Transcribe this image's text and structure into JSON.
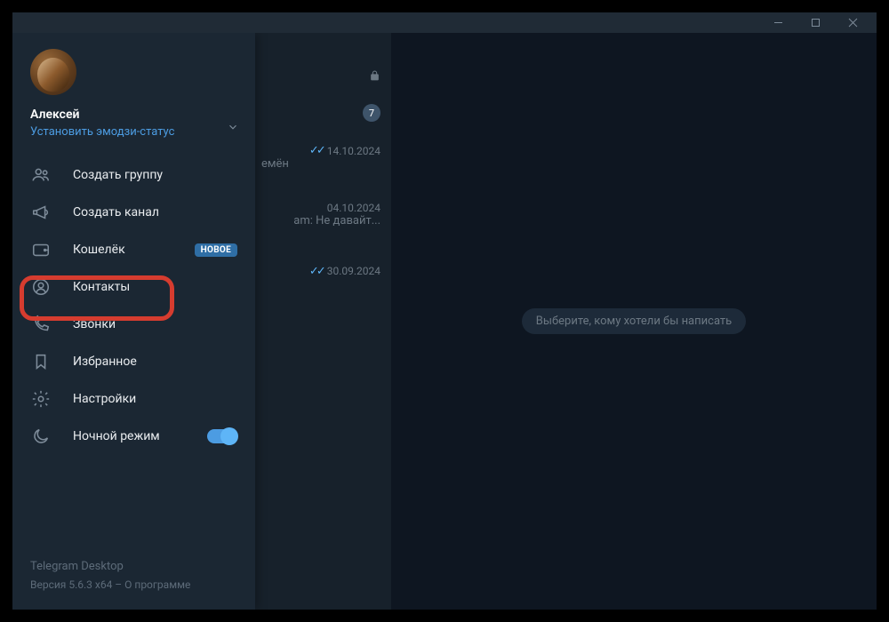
{
  "window": {
    "minimize": "—",
    "maximize": "▢",
    "close": "✕"
  },
  "chatarea": {
    "placeholder": "Выберите, кому хотели бы написать"
  },
  "chats": [
    {
      "preview": "",
      "date": "",
      "badge": "7",
      "lock": true
    },
    {
      "preview": "емён",
      "date": "14.10.2024",
      "checks": true
    },
    {
      "preview": "am:           Не давайт...",
      "date": "04.10.2024"
    },
    {
      "preview": "",
      "date": "30.09.2024",
      "checks": true
    }
  ],
  "profile": {
    "name": "Алексей",
    "status": "Установить эмодзи-статус"
  },
  "menu": {
    "create_group": "Создать группу",
    "create_channel": "Создать канал",
    "wallet": "Кошелёк",
    "wallet_badge": "НОВОЕ",
    "contacts": "Контакты",
    "calls": "Звонки",
    "saved": "Избранное",
    "settings": "Настройки",
    "night_mode": "Ночной режим"
  },
  "footer": {
    "app": "Telegram Desktop",
    "version_prefix": "Версия 5.6.3 x64 – ",
    "about": "О программе"
  }
}
